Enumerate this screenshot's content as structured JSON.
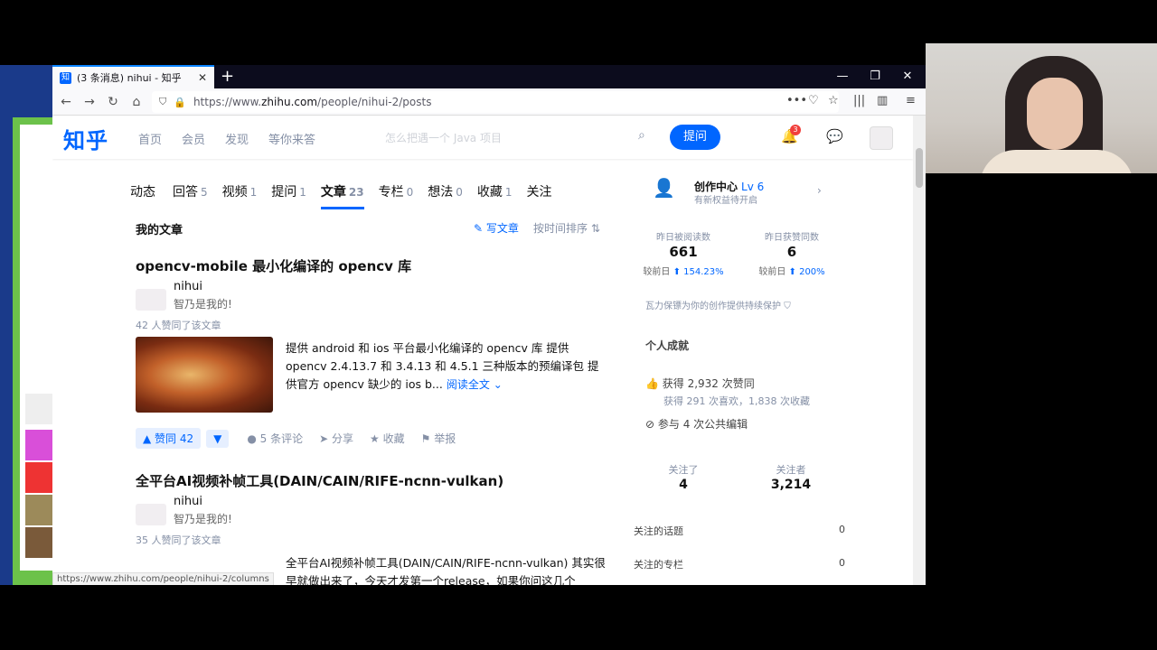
{
  "browser": {
    "tab_title": "(3 条消息) nihui - 知乎",
    "tab_favicon": "知",
    "url_prefix": "https://www.",
    "url_domain": "zhihu.com",
    "url_path": "/people/nihui-2/posts",
    "status_url": "https://www.zhihu.com/people/nihui-2/columns"
  },
  "header": {
    "logo": "知乎",
    "nav": [
      "首页",
      "会员",
      "发现",
      "等你来答"
    ],
    "search_placeholder": "怎么把遇一个 Java 项目",
    "ask_label": "提问",
    "notification_count": "3"
  },
  "profile_tabs": [
    {
      "label": "动态",
      "count": ""
    },
    {
      "label": "回答",
      "count": "5"
    },
    {
      "label": "视频",
      "count": "1"
    },
    {
      "label": "提问",
      "count": "1"
    },
    {
      "label": "文章",
      "count": "23"
    },
    {
      "label": "专栏",
      "count": "0"
    },
    {
      "label": "想法",
      "count": "0"
    },
    {
      "label": "收藏",
      "count": "1"
    },
    {
      "label": "关注",
      "count": ""
    }
  ],
  "section": {
    "title": "我的文章",
    "write_label": "写文章",
    "sort_label": "按时间排序"
  },
  "articles": [
    {
      "title": "opencv-mobile 最小化编译的 opencv 库",
      "author": "nihui",
      "bio": "智乃是我的!",
      "votes_text": "42 人赞同了该文章",
      "excerpt": "提供 android 和 ios 平台最小化编译的 opencv 库 提供 opencv 2.4.13.7 和 3.4.13 和 4.5.1 三种版本的预编译包 提供官方 opencv 缺少的 ios b...",
      "read_more": "阅读全文",
      "vote_label": "▲ 赞同 42",
      "down_label": "▼",
      "comments": "5 条评论",
      "share": "分享",
      "favorite": "收藏",
      "report": "举报"
    },
    {
      "title": "全平台AI视频补帧工具(DAIN/CAIN/RIFE-ncnn-vulkan)",
      "author": "nihui",
      "bio": "智乃是我的!",
      "votes_text": "35 人赞同了该文章",
      "excerpt": "全平台AI视频补帧工具(DAIN/CAIN/RIFE-ncnn-vulkan) 其实很早就做出来了，今天才发第一个release，如果你问这几个pytorch模"
    }
  ],
  "sidebar": {
    "creator_title": "创作中心",
    "creator_level": "Lv 6",
    "creator_sub": "有新权益待开启",
    "read_label": "昨日被阅读数",
    "read_value": "661",
    "read_delta_prefix": "较前日",
    "read_delta": "154.23%",
    "vote_label": "昨日获赞同数",
    "vote_value": "6",
    "vote_delta_prefix": "较前日",
    "vote_delta": "200%",
    "protect": "瓦力保镖为你的创作提供持续保护",
    "achievement_title": "个人成就",
    "achieve_votes": "获得 2,932 次赞同",
    "achieve_sub": "获得 291 次喜欢，1,838 次收藏",
    "achieve_edit": "参与 4 次公共编辑",
    "following_label": "关注了",
    "following_value": "4",
    "followers_label": "关注者",
    "followers_value": "3,214",
    "topics_label": "关注的话题",
    "topics_value": "0",
    "columns_label": "关注的专栏",
    "columns_value": "0"
  }
}
